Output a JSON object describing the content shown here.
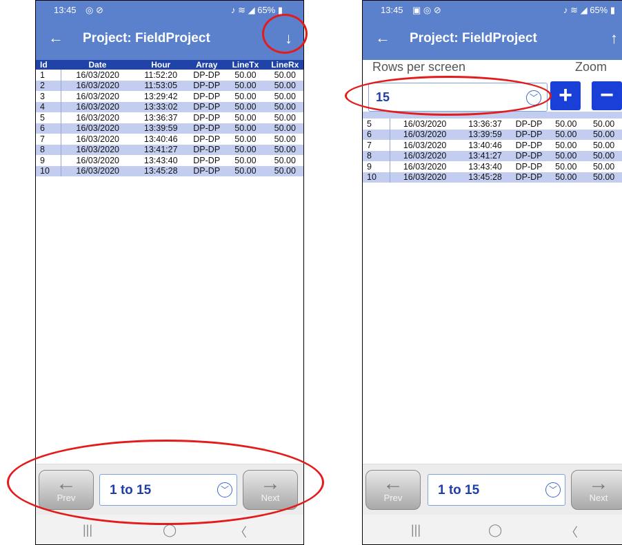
{
  "left": {
    "status": {
      "time": "13:45",
      "left_icons": "◎ ⊘",
      "right": "♪ ≋ ◢ 65% ▮"
    },
    "appbar": {
      "back": "←",
      "title": "Project: FieldProject",
      "sort": "↓"
    },
    "table": {
      "columns": [
        "Id",
        "Date",
        "Hour",
        "Array",
        "LineTx",
        "LineRx"
      ],
      "rows": [
        [
          "1",
          "16/03/2020",
          "11:52:20",
          "DP-DP",
          "50.00",
          "50.00"
        ],
        [
          "2",
          "16/03/2020",
          "11:53:05",
          "DP-DP",
          "50.00",
          "50.00"
        ],
        [
          "3",
          "16/03/2020",
          "13:29:42",
          "DP-DP",
          "50.00",
          "50.00"
        ],
        [
          "4",
          "16/03/2020",
          "13:33:02",
          "DP-DP",
          "50.00",
          "50.00"
        ],
        [
          "5",
          "16/03/2020",
          "13:36:37",
          "DP-DP",
          "50.00",
          "50.00"
        ],
        [
          "6",
          "16/03/2020",
          "13:39:59",
          "DP-DP",
          "50.00",
          "50.00"
        ],
        [
          "7",
          "16/03/2020",
          "13:40:46",
          "DP-DP",
          "50.00",
          "50.00"
        ],
        [
          "8",
          "16/03/2020",
          "13:41:27",
          "DP-DP",
          "50.00",
          "50.00"
        ],
        [
          "9",
          "16/03/2020",
          "13:43:40",
          "DP-DP",
          "50.00",
          "50.00"
        ],
        [
          "10",
          "16/03/2020",
          "13:45:28",
          "DP-DP",
          "50.00",
          "50.00"
        ]
      ]
    },
    "pager": {
      "prev": "Prev",
      "next": "Next",
      "range": "1 to 15"
    }
  },
  "right": {
    "status": {
      "time": "13:45",
      "left_icons": "▣ ◎ ⊘",
      "right": "♪ ≋ ◢ 65% ▮"
    },
    "appbar": {
      "back": "←",
      "title": "Project: FieldProject",
      "sort": "↑"
    },
    "rows_per_screen": {
      "label": "Rows per screen",
      "value": "15"
    },
    "zoom": {
      "label": "Zoom",
      "plus": "+",
      "minus": "−"
    },
    "table": {
      "rows": [
        [
          "5",
          "16/03/2020",
          "13:36:37",
          "DP-DP",
          "50.00",
          "50.00"
        ],
        [
          "6",
          "16/03/2020",
          "13:39:59",
          "DP-DP",
          "50.00",
          "50.00"
        ],
        [
          "7",
          "16/03/2020",
          "13:40:46",
          "DP-DP",
          "50.00",
          "50.00"
        ],
        [
          "8",
          "16/03/2020",
          "13:41:27",
          "DP-DP",
          "50.00",
          "50.00"
        ],
        [
          "9",
          "16/03/2020",
          "13:43:40",
          "DP-DP",
          "50.00",
          "50.00"
        ],
        [
          "10",
          "16/03/2020",
          "13:45:28",
          "DP-DP",
          "50.00",
          "50.00"
        ]
      ]
    },
    "pager": {
      "prev": "Prev",
      "next": "Next",
      "range": "1 to 15"
    }
  },
  "sysnav": {
    "recents": "|||",
    "home": "◯",
    "back": "〈"
  },
  "colors": {
    "appbar": "#5b80cc",
    "header": "#1f43a8",
    "alt_row": "#c3cdef",
    "accent_button": "#1a3fd6",
    "annotation": "#e31b1b"
  }
}
